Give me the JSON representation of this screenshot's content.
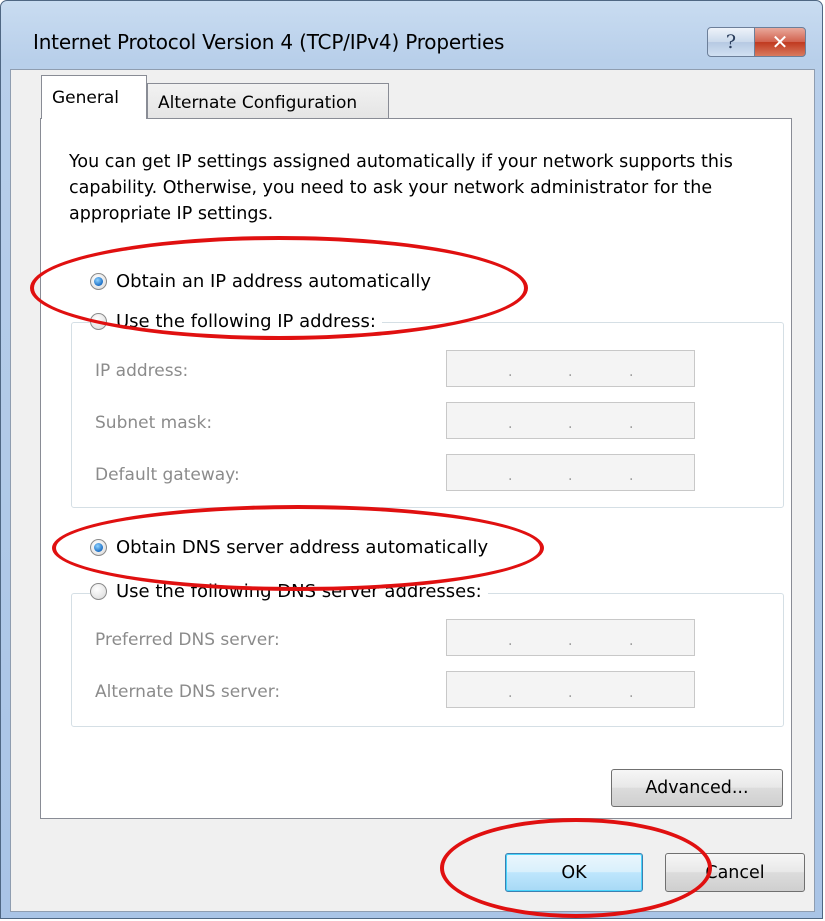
{
  "window": {
    "title": "Internet Protocol Version 4 (TCP/IPv4) Properties",
    "help_glyph": "?",
    "close_glyph": "✕"
  },
  "tabs": [
    {
      "label": "General",
      "selected": true
    },
    {
      "label": "Alternate Configuration",
      "selected": false
    }
  ],
  "general": {
    "description": "You can get IP settings assigned automatically if your network supports this capability. Otherwise, you need to ask your network administrator for the appropriate IP settings.",
    "ip_auto_label": "Obtain an IP address automatically",
    "ip_auto_selected": true,
    "ip_manual_label": "Use the following IP address:",
    "ip_fields": [
      {
        "label": "IP address:",
        "value": ". . ."
      },
      {
        "label": "Subnet mask:",
        "value": ". . ."
      },
      {
        "label": "Default gateway:",
        "value": ". . ."
      }
    ],
    "dns_auto_label": "Obtain DNS server address automatically",
    "dns_auto_selected": true,
    "dns_manual_label": "Use the following DNS server addresses:",
    "dns_fields": [
      {
        "label": "Preferred DNS server:",
        "value": ". . ."
      },
      {
        "label": "Alternate DNS server:",
        "value": ". . ."
      }
    ],
    "advanced_label": "Advanced..."
  },
  "footer": {
    "ok_label": "OK",
    "cancel_label": "Cancel"
  },
  "annotation_color": "#e01010",
  "icons": [
    "help-icon",
    "close-icon"
  ]
}
